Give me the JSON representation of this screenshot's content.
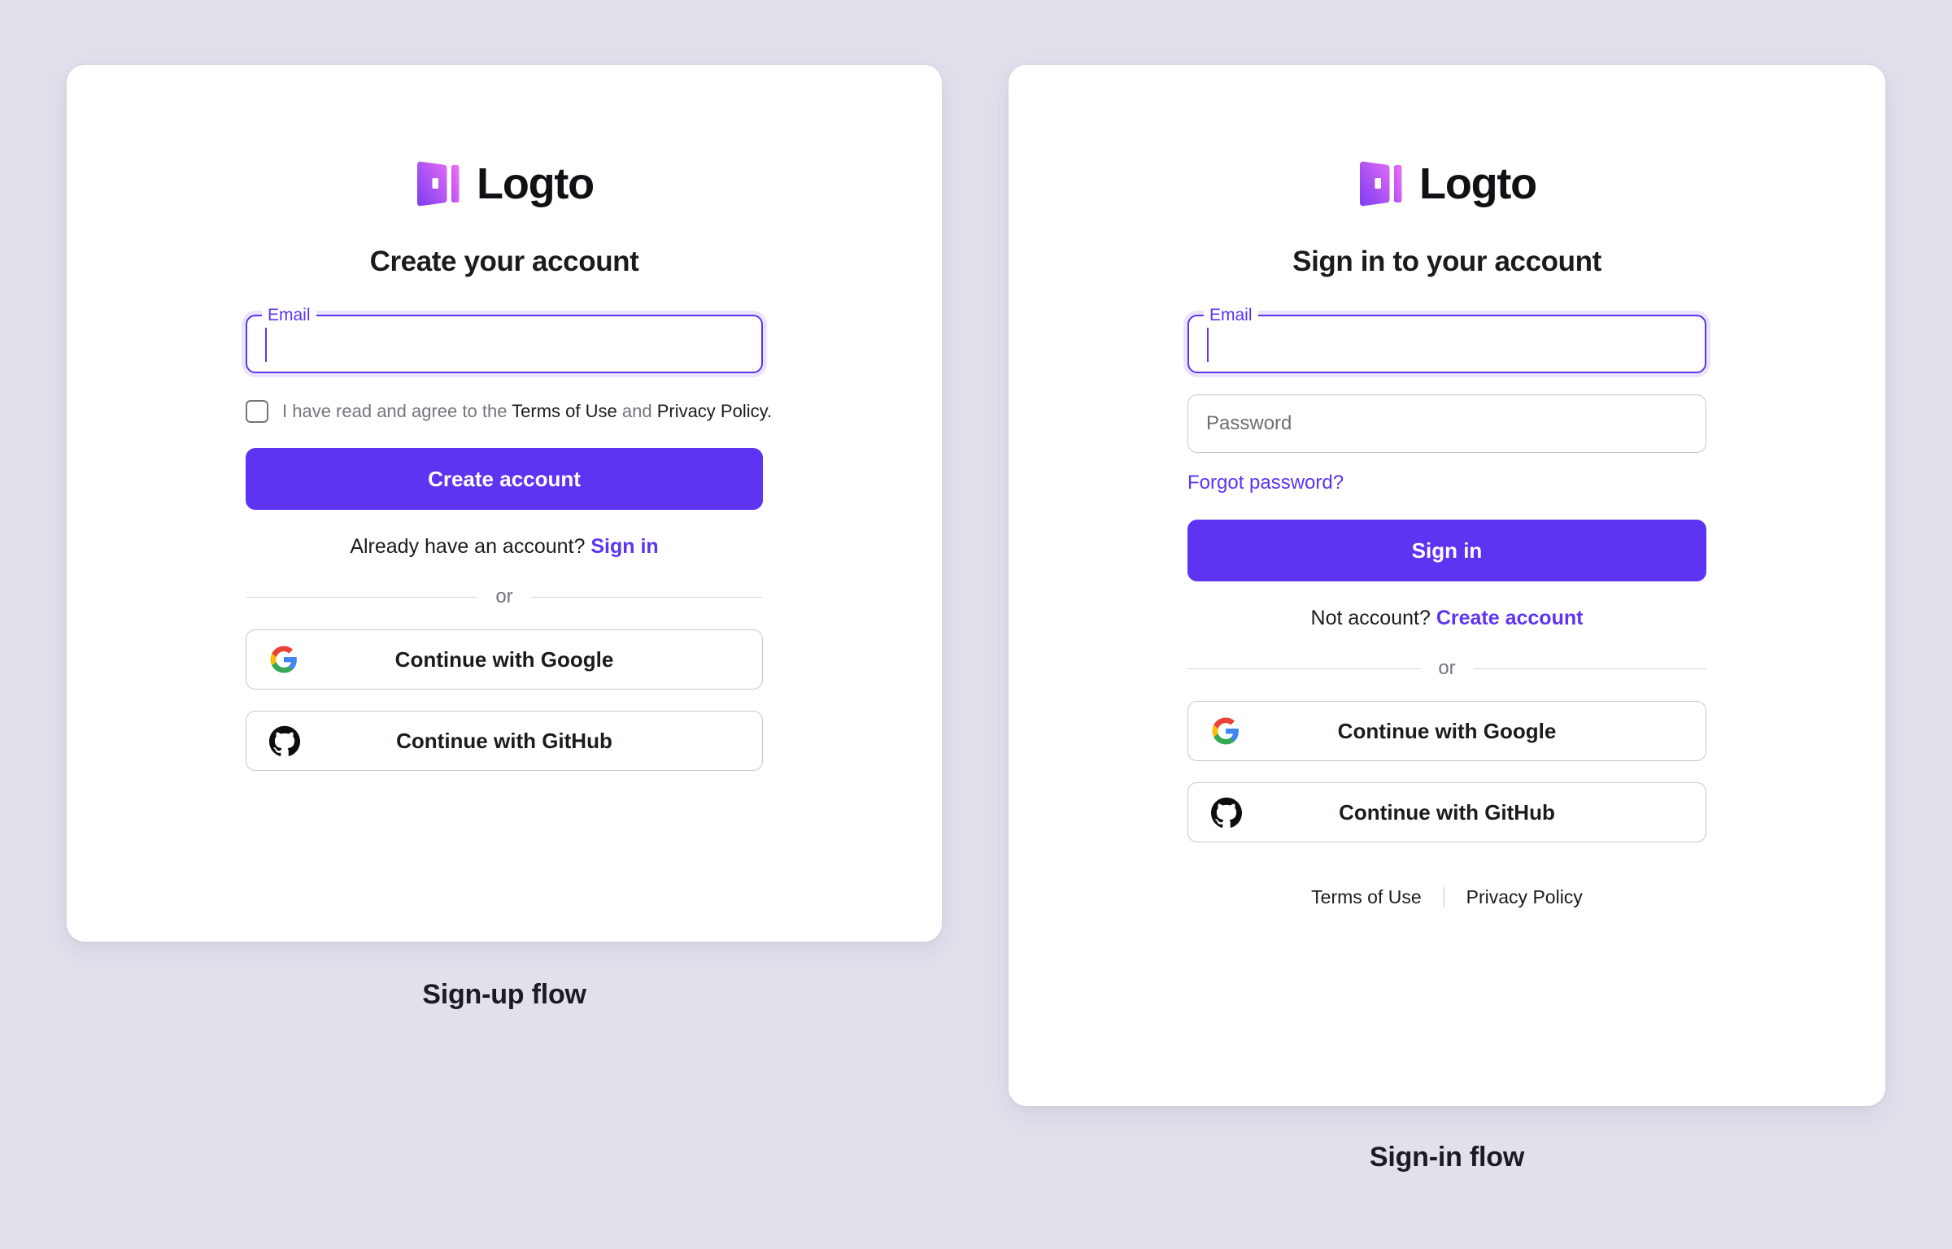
{
  "page": {
    "background_color": "#e3e0ec",
    "accent_color": "#5d34f2"
  },
  "brand": {
    "name": "Logto",
    "mark_icon": "logto-door-logo",
    "gradient_from": "#7b3df0",
    "gradient_to": "#e26bf5"
  },
  "signup": {
    "caption": "Sign-up flow",
    "heading": "Create your account",
    "email": {
      "label": "Email",
      "value": "",
      "placeholder": ""
    },
    "terms": {
      "prefix": "I have read and agree to the ",
      "terms_link": "Terms of Use",
      "conjunction": " and ",
      "privacy_link": "Privacy Policy",
      "suffix": ".",
      "checked": false
    },
    "submit_label": "Create account",
    "switch": {
      "prompt": "Already have an account?",
      "link": "Sign in"
    },
    "divider_label": "or",
    "social": [
      {
        "label": "Continue with Google",
        "icon": "google-icon"
      },
      {
        "label": "Continue with GitHub",
        "icon": "github-icon"
      }
    ]
  },
  "signin": {
    "caption": "Sign-in flow",
    "heading": "Sign in to your account",
    "email": {
      "label": "Email",
      "value": "",
      "placeholder": ""
    },
    "password": {
      "value": "",
      "placeholder": "Password"
    },
    "forgot_label": "Forgot password?",
    "submit_label": "Sign in",
    "switch": {
      "prompt": "Not account?",
      "link": "Create account"
    },
    "divider_label": "or",
    "social": [
      {
        "label": "Continue with Google",
        "icon": "google-icon"
      },
      {
        "label": "Continue with GitHub",
        "icon": "github-icon"
      }
    ],
    "footer": {
      "terms_link": "Terms of Use",
      "privacy_link": "Privacy Policy"
    }
  }
}
